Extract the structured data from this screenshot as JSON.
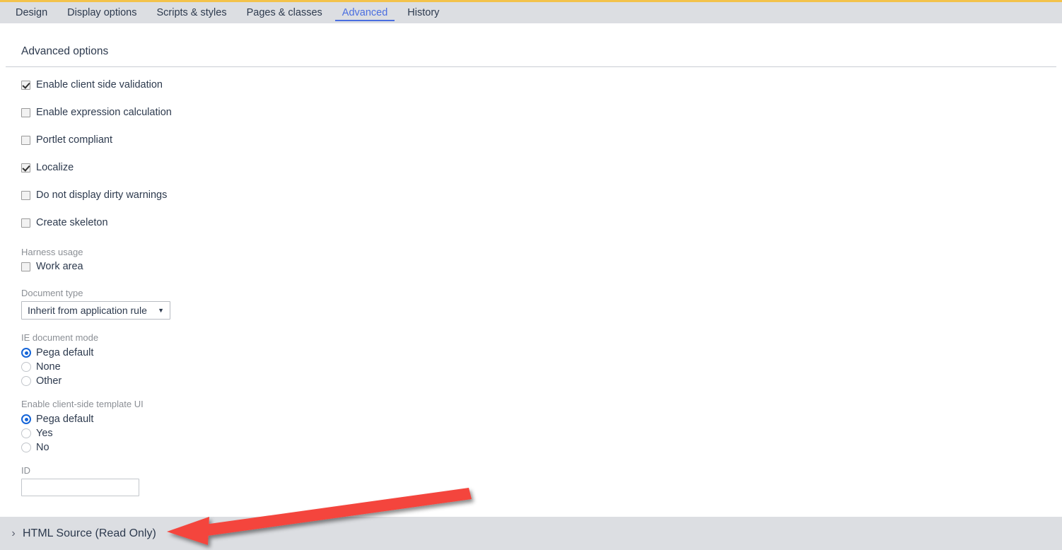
{
  "theme": {
    "accent_top": "#f3c24b",
    "tabbar_bg": "#dcdee2",
    "active_tab": "#4a6ee0",
    "text": "#2d3a4e",
    "muted_label": "#8b8f95",
    "radio_on": "#1565d8",
    "arrow_red": "#f4443c"
  },
  "tabs": [
    {
      "label": "Design",
      "active": false
    },
    {
      "label": "Display options",
      "active": false
    },
    {
      "label": "Scripts & styles",
      "active": false
    },
    {
      "label": "Pages & classes",
      "active": false
    },
    {
      "label": "Advanced",
      "active": true
    },
    {
      "label": "History",
      "active": false
    }
  ],
  "panel": {
    "title": "Advanced options",
    "checkboxes": [
      {
        "label": "Enable client side validation",
        "checked": true
      },
      {
        "label": "Enable expression calculation",
        "checked": false
      },
      {
        "label": "Portlet compliant",
        "checked": false
      },
      {
        "label": "Localize",
        "checked": true
      },
      {
        "label": "Do not display dirty warnings",
        "checked": false
      },
      {
        "label": "Create skeleton",
        "checked": false
      }
    ],
    "harness_usage": {
      "label": "Harness usage",
      "checkbox": {
        "label": "Work area",
        "checked": false
      }
    },
    "document_type": {
      "label": "Document type",
      "value": "Inherit from application rule",
      "caret": "▼",
      "options": [
        "Inherit from application rule"
      ]
    },
    "ie_document_mode": {
      "label": "IE document mode",
      "options": [
        {
          "label": "Pega default",
          "selected": true
        },
        {
          "label": "None",
          "selected": false
        },
        {
          "label": "Other",
          "selected": false
        }
      ]
    },
    "client_side_template_ui": {
      "label": "Enable client-side template UI",
      "options": [
        {
          "label": "Pega default",
          "selected": true
        },
        {
          "label": "Yes",
          "selected": false
        },
        {
          "label": "No",
          "selected": false
        }
      ]
    },
    "id_field": {
      "label": "ID",
      "value": "",
      "placeholder": ""
    }
  },
  "bottom_bar": {
    "chevron": "›",
    "title": "HTML Source (Read Only)"
  },
  "annotation": {
    "type": "arrow",
    "color": "#f4443c",
    "points_to": "HTML Source (Read Only)"
  }
}
